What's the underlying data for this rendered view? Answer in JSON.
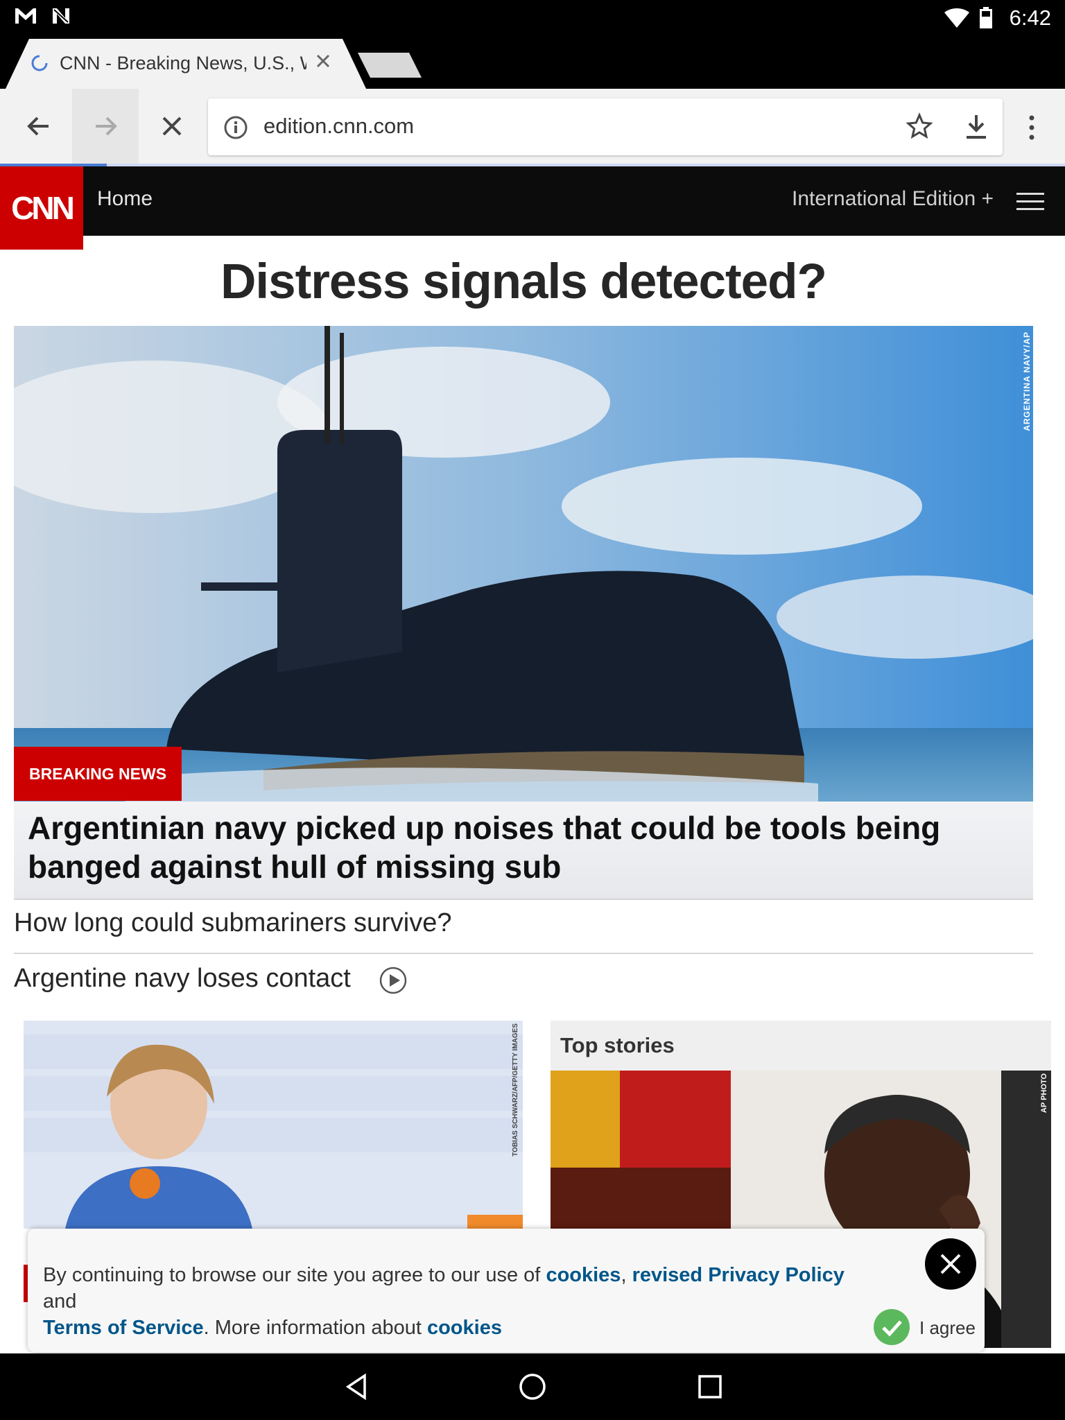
{
  "status_bar": {
    "time": "6:42"
  },
  "browser": {
    "tab_title": "CNN - Breaking News, U.S., W",
    "url": "edition.cnn.com"
  },
  "site": {
    "logo": "CNN",
    "nav_home": "Home",
    "edition": "International Edition +"
  },
  "headline": "Distress signals detected?",
  "hero": {
    "credit": "ARGENTINA NAVY/AP",
    "badge": "BREAKING NEWS",
    "caption": "Argentinian navy picked up noises that could be tools being banged against hull of missing sub"
  },
  "related": [
    {
      "text": "How long could submariners survive?"
    },
    {
      "text": "Argentine navy loses contact"
    }
  ],
  "cards": {
    "merkel_credit": "TOBIAS SCHWARZ/AFP/GETTY IMAGES",
    "top_stories_title": "Top stories",
    "mugabe_credit": "AP PHOTO"
  },
  "cookie": {
    "t1": "By continuing to browse our site you agree to our use of ",
    "l1": "cookies",
    "t2": ", ",
    "l2": "revised Privacy Policy",
    "t3": " and ",
    "l3": "Terms of Service",
    "t4": ". More information about ",
    "l4": "cookies",
    "agree": "I agree"
  },
  "colors": {
    "cnn_red": "#cc0000",
    "link_blue": "#005689",
    "agree_green": "#5cb85c"
  }
}
